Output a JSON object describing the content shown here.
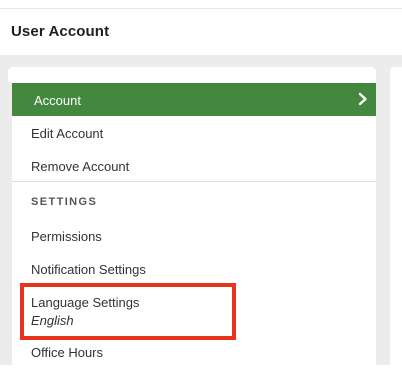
{
  "page": {
    "title": "User Account"
  },
  "sidebar": {
    "active_item": {
      "label": "Account",
      "icon": "chevron-right-icon"
    },
    "items": [
      {
        "label": "Edit Account"
      },
      {
        "label": "Remove Account"
      }
    ],
    "settings_section": {
      "heading": "SETTINGS",
      "items": [
        {
          "label": "Permissions"
        },
        {
          "label": "Notification Settings"
        },
        {
          "label": "Language Settings",
          "value": "English"
        },
        {
          "label": "Office Hours"
        }
      ]
    }
  },
  "colors": {
    "active_bg": "#44883f",
    "highlight_border": "#e8341c",
    "panel_bg": "#ececec"
  }
}
